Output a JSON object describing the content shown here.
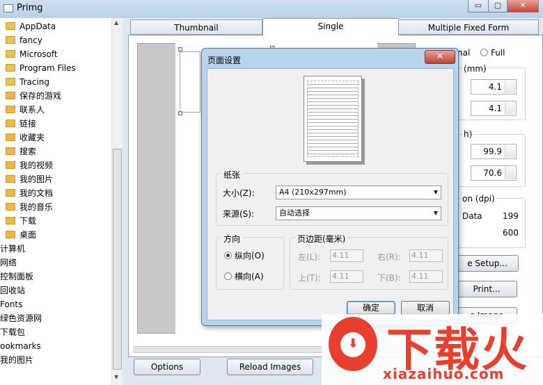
{
  "window": {
    "title": "Primg",
    "min": "▭",
    "max": "▢",
    "close": "✕"
  },
  "tree": {
    "items": [
      {
        "label": "AppData",
        "icon": "folder-icon"
      },
      {
        "label": "fancy",
        "icon": "folder-icon"
      },
      {
        "label": "Microsoft",
        "icon": "folder-icon"
      },
      {
        "label": "Program Files",
        "icon": "folder-icon"
      },
      {
        "label": "Tracing",
        "icon": "folder-icon"
      },
      {
        "label": "保存的游戏",
        "icon": "special-folder-icon"
      },
      {
        "label": "联系人",
        "icon": "special-folder-icon"
      },
      {
        "label": "链接",
        "icon": "special-folder-icon"
      },
      {
        "label": "收藏夹",
        "icon": "special-folder-icon"
      },
      {
        "label": "搜索",
        "icon": "special-folder-icon"
      },
      {
        "label": "我的视频",
        "icon": "special-folder-icon"
      },
      {
        "label": "我的图片",
        "icon": "special-folder-icon"
      },
      {
        "label": "我的文档",
        "icon": "special-folder-icon"
      },
      {
        "label": "我的音乐",
        "icon": "special-folder-icon"
      },
      {
        "label": "下载",
        "icon": "special-folder-icon"
      },
      {
        "label": "桌面",
        "icon": "special-folder-icon"
      },
      {
        "label": "计算机",
        "icon": ""
      },
      {
        "label": "网络",
        "icon": ""
      },
      {
        "label": "控制面板",
        "icon": ""
      },
      {
        "label": "回收站",
        "icon": ""
      },
      {
        "label": "Fonts",
        "icon": ""
      },
      {
        "label": "绿色资源网",
        "icon": ""
      },
      {
        "label": "下载包",
        "icon": ""
      },
      {
        "label": "ookmarks",
        "icon": ""
      },
      {
        "label": "我的图片",
        "icon": ""
      }
    ]
  },
  "tabs": [
    "Thumbnail",
    "Single",
    "Multiple Fixed Form"
  ],
  "right_panel": {
    "orientation_tail": "nal",
    "full_label": "Full",
    "margin_group_tail": "(mm)",
    "margin_values": [
      "4.1",
      "4.1"
    ],
    "size_group_tail": "h)",
    "size_values": [
      "99.9",
      "70.6"
    ],
    "resolution_tail": "on (dpi)",
    "data_label": "Data",
    "data_value": "199",
    "dpi_value": "600",
    "page_setup_tail": "e Setup...",
    "print_tail": "Print...",
    "save_image_tail": "e Image"
  },
  "bottom": {
    "options": "Options",
    "reload": "Reload Images"
  },
  "dialog": {
    "title": "页面设置",
    "close": "✕",
    "paper_group": "纸张",
    "size_label": "大小(Z):",
    "size_value": "A4 (210x297mm)",
    "source_label": "来源(S):",
    "source_value": "自动选择",
    "orientation_group": "方向",
    "portrait": "纵向(O)",
    "landscape": "横向(A)",
    "margins_group": "页边距(毫米)",
    "left_label": "左(L):",
    "left_value": "4.11",
    "right_label": "右(R):",
    "right_value": "4.11",
    "top_label": "上(T):",
    "top_value": "4.11",
    "bottom_label": "下(B):",
    "bottom_value": "4.11",
    "ok": "确定",
    "cancel": "取消"
  },
  "watermark": {
    "brand": "下载火",
    "url": "xiazaihuo.com"
  }
}
